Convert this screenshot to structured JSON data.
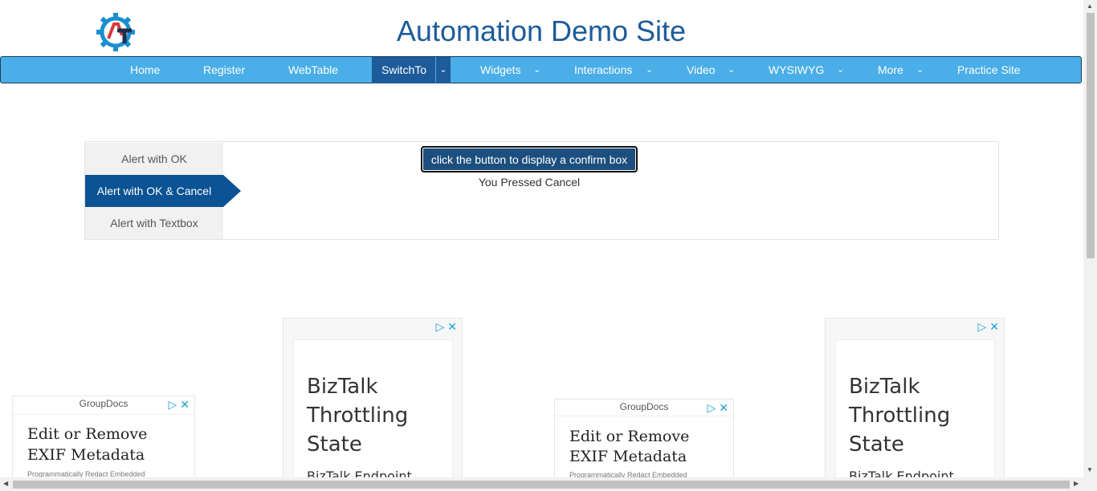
{
  "header": {
    "title": "Automation Demo Site"
  },
  "nav": {
    "items": [
      {
        "label": "Home"
      },
      {
        "label": "Register"
      },
      {
        "label": "WebTable"
      },
      {
        "label": "SwitchTo"
      },
      {
        "label": "Widgets"
      },
      {
        "label": "Interactions"
      },
      {
        "label": "Video"
      },
      {
        "label": "WYSIWYG"
      },
      {
        "label": "More"
      },
      {
        "label": "Practice Site"
      }
    ],
    "active": "SwitchTo",
    "accent_color": "#4aaee8",
    "active_color": "#1d5b9a"
  },
  "tabs": [
    {
      "label": "Alert with OK"
    },
    {
      "label": "Alert with OK & Cancel"
    },
    {
      "label": "Alert with Textbox"
    }
  ],
  "active_tab": "Alert with OK & Cancel",
  "confirm": {
    "button_label": "click the button to display a confirm box",
    "result": "You Pressed Cancel"
  },
  "ads": {
    "small": {
      "brand": "GroupDocs",
      "title_line1": "Edit or Remove",
      "title_line2": "EXIF Metadata",
      "subtitle": "Programmatically Redact Embedded"
    },
    "big": {
      "title_line1": "BizTalk",
      "title_line2": "Throttling",
      "title_line3": "State",
      "subtitle": "BizTalk Endpoint"
    }
  }
}
